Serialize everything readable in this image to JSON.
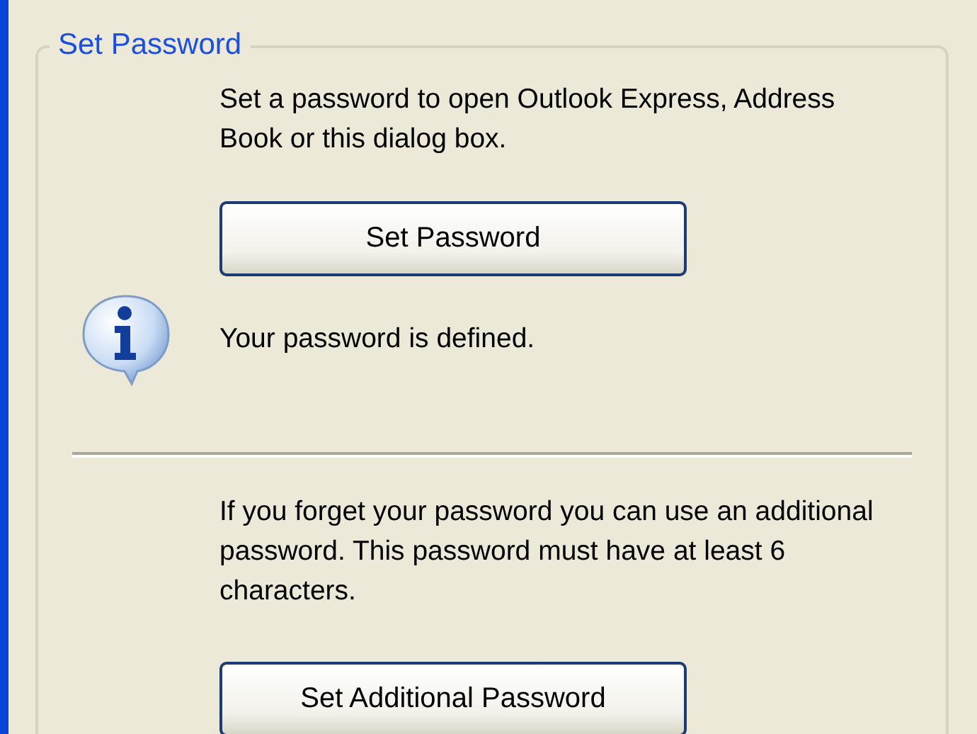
{
  "group": {
    "title": "Set Password"
  },
  "description": "Set a password to open Outlook Express, Address Book or this dialog box.",
  "set_password_button": {
    "label": "Set Password"
  },
  "status": {
    "text": "Your password is defined."
  },
  "additional_description": "If you forget your password you can use an additional password. This password must have at least 6 characters.",
  "additional_button": {
    "label": "Set Additional Password"
  }
}
